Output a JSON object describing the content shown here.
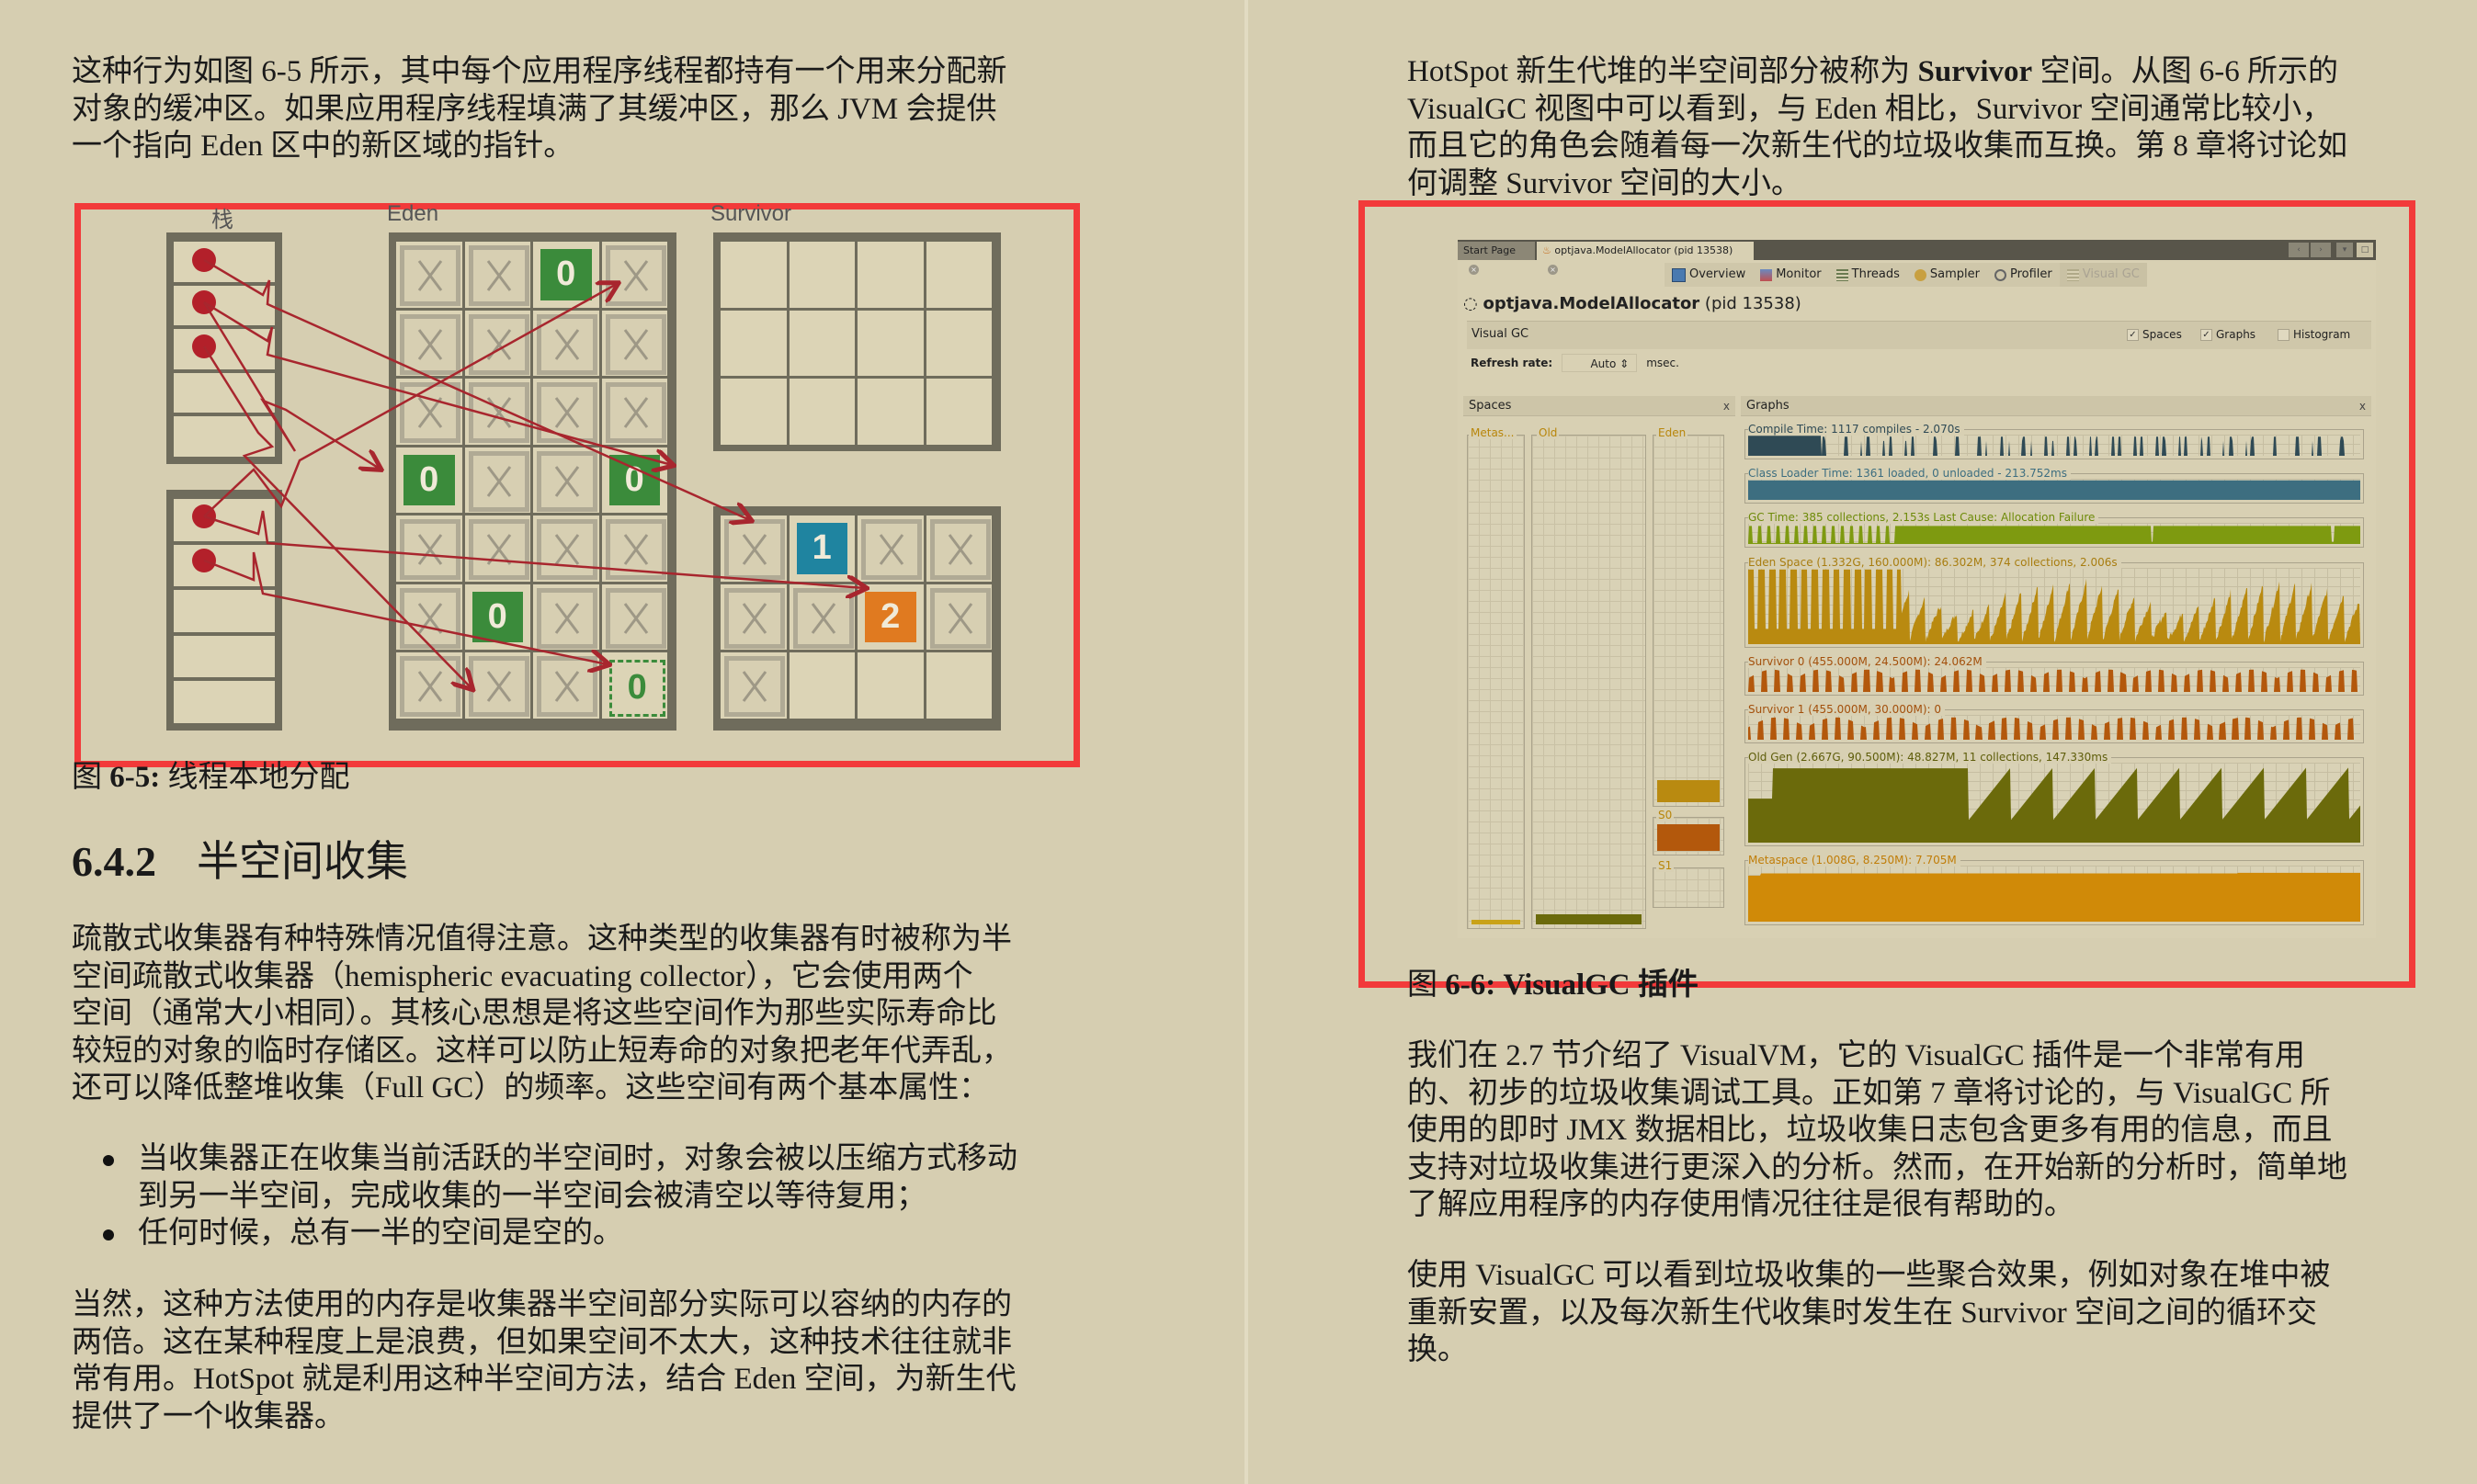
{
  "left_page": {
    "intro_lines": [
      "这种行为如图 6-5 所示，其中每个应用程序线程都持有一个用来分配新",
      "对象的缓冲区。如果应用程序线程填满了其缓冲区，那么 JVM 会提供",
      "一个指向 Eden 区中的新区域的指针。"
    ],
    "figure_6_5": {
      "labels": {
        "stack": "栈",
        "eden": "Eden",
        "survivor": "Survivor"
      },
      "eden_objects": [
        "0",
        "0",
        "0",
        "0",
        "0"
      ],
      "survivor_objects": [
        "1",
        "2"
      ],
      "caption_prefix": "图 ",
      "caption_num": "6-5:",
      "caption_text": " 线程本地分配"
    },
    "section": {
      "number": "6.4.2",
      "title": "半空间收集"
    },
    "para1_lines": [
      "疏散式收集器有种特殊情况值得注意。这种类型的收集器有时被称为半",
      "空间疏散式收集器（hemispheric evacuating collector），它会使用两个",
      "空间（通常大小相同）。其核心思想是将这些空间作为那些实际寿命比",
      "较短的对象的临时存储区。这样可以防止短寿命的对象把老年代弄乱，",
      "还可以降低整堆收集（Full GC）的频率。这些空间有两个基本属性："
    ],
    "bullets": [
      [
        "当收集器正在收集当前活跃的半空间时，对象会被以压缩方式移动",
        "到另一半空间，完成收集的一半空间会被清空以等待复用；"
      ],
      [
        "任何时候，总有一半的空间是空的。"
      ]
    ],
    "para2_lines": [
      "当然，这种方法使用的内存是收集器半空间部分实际可以容纳的内存的",
      "两倍。这在某种程度上是浪费，但如果空间不太大，这种技术往往就非",
      "常有用。HotSpot 就是利用这种半空间方法，结合 Eden 空间，为新生代",
      "提供了一个收集器。"
    ]
  },
  "right_page": {
    "intro": {
      "l1_a": "HotSpot 新生代堆的半空间部分被称为 ",
      "l1_bold": "Survivor",
      "l1_b": " 空间。从图 6-6 所示的",
      "l2": "VisualGC 视图中可以看到，与 Eden 相比，Survivor 空间通常比较小，",
      "l3": "而且它的角色会随着每一次新生代的垃圾收集而互换。第 8 章将讨论如",
      "l4": "何调整 Survivor 空间的大小。"
    },
    "figure_6_6": {
      "caption_prefix": "图 ",
      "caption_num": "6-6:",
      "caption_text": " VisualGC 插件"
    },
    "para1_lines": [
      "我们在 2.7 节介绍了 VisualVM，它的 VisualGC 插件是一个非常有用",
      "的、初步的垃圾收集调试工具。正如第 7 章将讨论的，与 VisualGC 所",
      "使用的即时 JMX 数据相比，垃圾收集日志包含更多有用的信息，而且",
      "支持对垃圾收集进行更深入的分析。然而，在开始新的分析时，简单地",
      "了解应用程序的内存使用情况往往是很有帮助的。"
    ],
    "para2_lines": [
      "使用 VisualGC 可以看到垃圾收集的一些聚合效果，例如对象在堆中被",
      "重新安置，以及每次新生代收集时发生在 Survivor 空间之间的循环交",
      "换。"
    ]
  },
  "visualgc": {
    "tabs": [
      {
        "label": "Start Page",
        "close": "×"
      },
      {
        "label": "optjava.ModelAllocator (pid 13538)",
        "close": "×",
        "active": true
      }
    ],
    "window_controls": [
      "‹",
      "›",
      "▾",
      "□"
    ],
    "subtabs": [
      {
        "label": "Overview",
        "icon": "overview-icon"
      },
      {
        "label": "Monitor",
        "icon": "monitor-icon"
      },
      {
        "label": "Threads",
        "icon": "threads-icon"
      },
      {
        "label": "Sampler",
        "icon": "sampler-icon"
      },
      {
        "label": "Profiler",
        "icon": "profiler-icon"
      },
      {
        "label": "Visual GC",
        "icon": "visualgc-icon",
        "active": true
      }
    ],
    "process_name": "optjava.ModelAllocator",
    "process_pid": "(pid 13538)",
    "bar_title": "Visual GC",
    "checkboxes": [
      {
        "label": "Spaces",
        "checked": true
      },
      {
        "label": "Graphs",
        "checked": true
      },
      {
        "label": "Histogram",
        "checked": false
      }
    ],
    "refresh_label": "Refresh rate:",
    "refresh_value": "Auto",
    "refresh_unit": "msec.",
    "spaces_panel": {
      "title": "Spaces",
      "close": "x",
      "labels": {
        "metaspace": "Metas...",
        "old": "Old",
        "eden": "Eden",
        "s0": "S0",
        "s1": "S1"
      },
      "fill_fraction": {
        "metaspace": 0.01,
        "old": 0.02,
        "eden": 0.06,
        "s0": 0.9,
        "s1": 0.0
      }
    },
    "graphs_panel": {
      "title": "Graphs",
      "close": "x",
      "graphs": [
        {
          "key": "compile",
          "label": "Compile Time: 1117 compiles - 2.070s",
          "color": "#2f4a55"
        },
        {
          "key": "classloader",
          "label": "Class Loader Time: 1361 loaded, 0 unloaded - 213.752ms",
          "color": "#3d6e80"
        },
        {
          "key": "gctime",
          "label": "GC Time: 385 collections, 2.153s  Last Cause: Allocation Failure",
          "color": "#7e9a10"
        },
        {
          "key": "eden",
          "label": "Eden Space (1.332G, 160.000M): 86.302M, 374 collections, 2.006s",
          "color": "#b98a10"
        },
        {
          "key": "s0",
          "label": "Survivor 0 (455.000M, 24.500M): 24.062M",
          "color": "#b3580c"
        },
        {
          "key": "s1",
          "label": "Survivor 1 (455.000M, 30.000M): 0",
          "color": "#b3580c"
        },
        {
          "key": "old",
          "label": "Old Gen (2.667G, 90.500M): 48.827M, 11 collections, 147.330ms",
          "color": "#6b6a0b"
        },
        {
          "key": "meta",
          "label": "Metaspace (1.008G, 8.250M): 7.705M",
          "color": "#d08a08"
        }
      ]
    }
  }
}
